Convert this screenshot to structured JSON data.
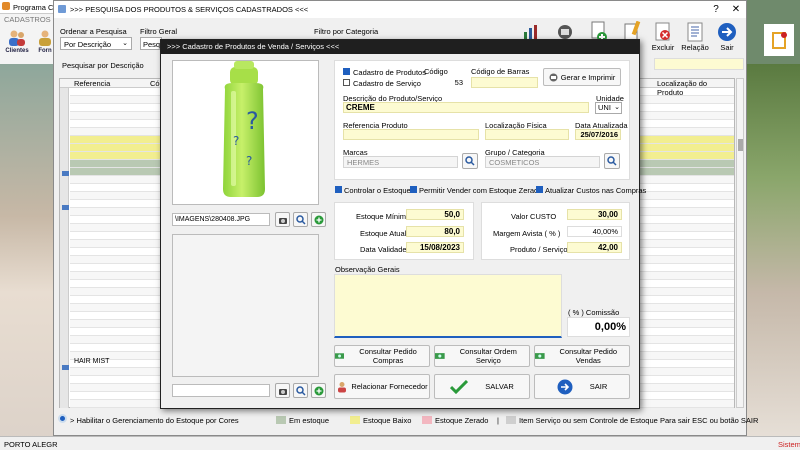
{
  "background_app": {
    "title": "Programa C",
    "menu": "CADASTROS",
    "clientes": "Clientes",
    "fornecedores": "Forn",
    "status_left": "PORTO ALEGR",
    "status_right": "Sistem"
  },
  "search_window": {
    "title": ">>>  PESQUISA DOS PRODUTOS & SERVIÇOS CADASTRADOS  <<<",
    "order_label": "Ordenar a Pesquisa",
    "order_value": "Por Descrição",
    "filter_label": "Filtro Geral",
    "filter_value": "Pesq",
    "category_filter_label": "Filtro por Categoria",
    "search_by_label": "Pesquisar por Descrição",
    "toolbar": {
      "excluir": "Excluir",
      "relacao": "Relação",
      "sair": "Sair"
    },
    "columns": {
      "referencia": "Referencia",
      "codigo": "Códig",
      "localizacao": "Localização do Produto"
    },
    "row_text": "HAIR MIST",
    "bottom": {
      "habilitar": "> Habilitar o Gerenciamento do Estoque por Cores",
      "em_estoque": "Em estoque",
      "estoque_baixo": "Estoque Baixo",
      "estoque_zerado": "Estoque Zerado",
      "sem_controle": "Item Serviço ou sem Controle de Estoque",
      "sair_hint": "Para sair ESC ou botão SAIR"
    },
    "colors": {
      "em_estoque": "#b9c9b3",
      "estoque_baixo": "#f2ee90",
      "estoque_zerado": "#f3b7c0",
      "sem_controle": "#cfcfcf"
    }
  },
  "modal": {
    "title": ">>>  Cadastro de Produtos de Venda / Serviços  <<<",
    "image_path": "\\IMAGENS\\280408.JPG",
    "cadastro_produtos": "Cadastro de Produtos",
    "cadastro_servico": "Cadastro de Serviço",
    "codigo_label": "Código",
    "codigo_value": "53",
    "barcode_label": "Código de Barras",
    "barcode_value": "",
    "gerar_imprimir": "Gerar e Imprimir",
    "descricao_label": "Descrição do Produto/Serviço",
    "descricao_value": "CREME",
    "unidade_label": "Unidade",
    "unidade_value": "UNI",
    "referencia_label": "Referencia Produto",
    "referencia_value": "",
    "localizacao_label": "Localização Física",
    "localizacao_value": "",
    "data_atualizada_label": "Data Atualizada",
    "data_atualizada_value": "25/07/2016",
    "marcas_label": "Marcas",
    "marcas_value": "HERMES",
    "grupo_label": "Grupo / Categoria",
    "grupo_value": "COSMETICOS",
    "controlar_estoque": "Controlar o Estoque",
    "permitir_vender": "Permitir Vender com Estoque Zerado",
    "atualizar_custos": "Atualizar Custos nas Compras",
    "estoque_minimo_label": "Estoque Mínimo",
    "estoque_minimo_value": "50,0",
    "estoque_atual_label": "Estoque Atual",
    "estoque_atual_value": "80,0",
    "data_validade_label": "Data Validade",
    "data_validade_value": "15/08/2023",
    "valor_custo_label": "Valor CUSTO",
    "valor_custo_value": "30,00",
    "margem_label": "Margem Avista ( % )",
    "margem_value": "40,00%",
    "produto_servico_label": "Produto / Serviço",
    "produto_servico_value": "42,00",
    "observacao_label": "Observação Gerais",
    "comissao_label": "( % ) Comissão",
    "comissao_value": "0,00%",
    "btn_pedido_compras": "Consultar Pedido Compras",
    "btn_ordem_servico": "Consultar Ordem Serviço",
    "btn_pedido_vendas": "Consultar Pedido Vendas",
    "btn_fornecedor": "Relacionar Fornecedor",
    "btn_salvar": "SALVAR",
    "btn_sair": "SAIR"
  }
}
